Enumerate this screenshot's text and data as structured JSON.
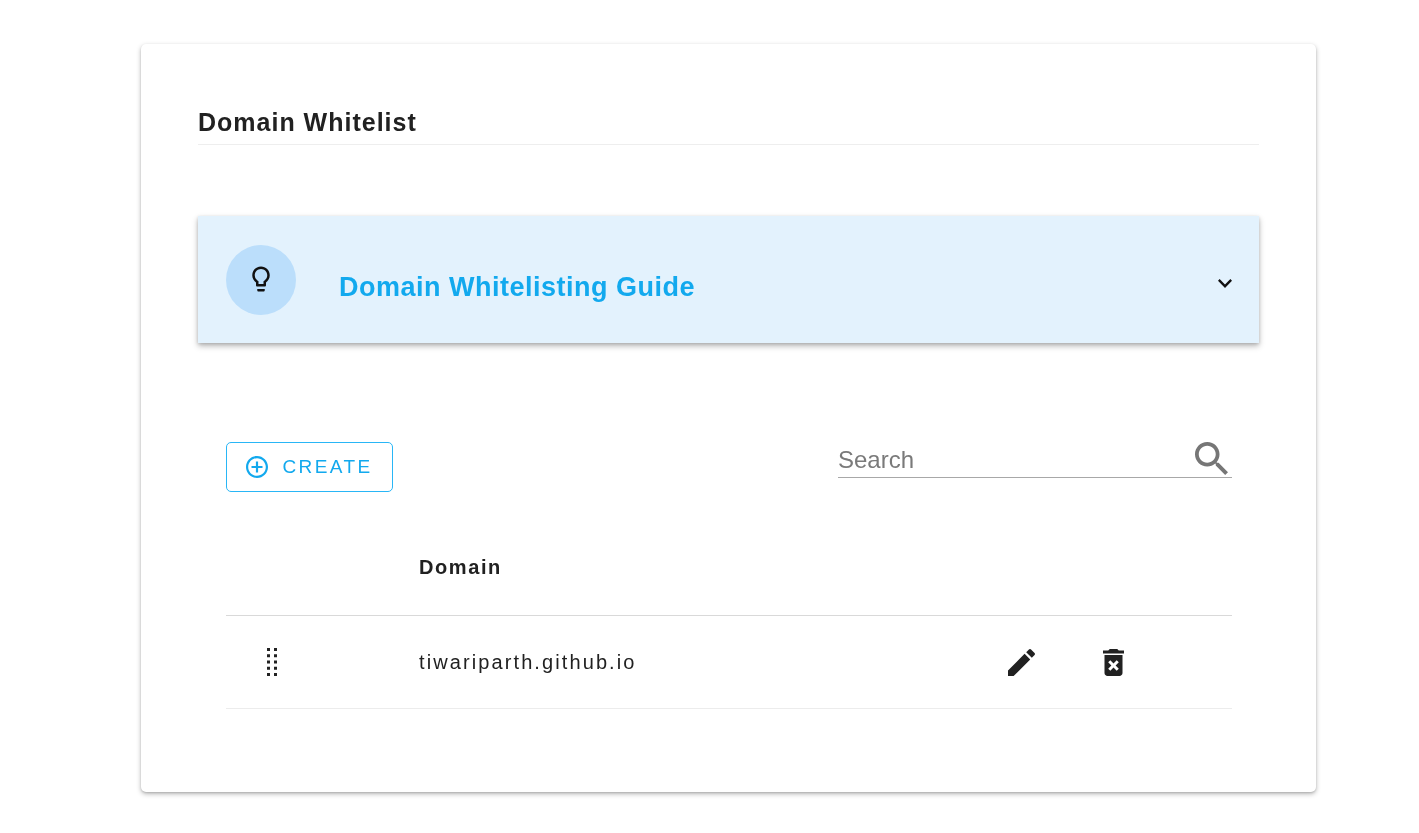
{
  "panel": {
    "title": "Domain Whitelist"
  },
  "guide": {
    "title": "Domain Whitelisting Guide",
    "expanded": false
  },
  "toolbar": {
    "create_button": "CREATE",
    "search": {
      "placeholder": "Search"
    }
  },
  "table": {
    "columns": [
      "Domain"
    ],
    "rows": [
      {
        "domain": "tiwariparth.github.io"
      }
    ]
  }
}
